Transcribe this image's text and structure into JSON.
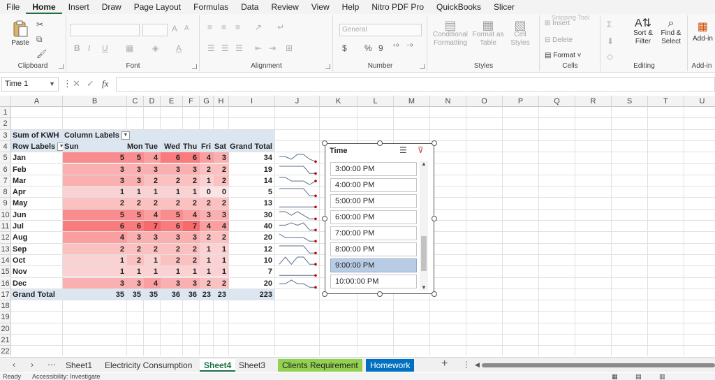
{
  "menu": [
    "File",
    "Home",
    "Insert",
    "Draw",
    "Page Layout",
    "Formulas",
    "Data",
    "Review",
    "View",
    "Help",
    "Nitro PDF Pro",
    "QuickBooks",
    "Slicer"
  ],
  "active_menu": "Home",
  "ribbon": {
    "clipboard": {
      "label": "Clipboard",
      "paste": "Paste"
    },
    "font": {
      "label": "Font",
      "bold": "B",
      "italic": "I",
      "underline": "U"
    },
    "alignment": {
      "label": "Alignment"
    },
    "number": {
      "label": "Number",
      "format": "General",
      "currency": "$",
      "percent": "%",
      "comma": "9"
    },
    "styles": {
      "label": "Styles",
      "conditional": "Conditional Formatting",
      "format_table": "Format as Table",
      "cell_styles": "Cell Styles"
    },
    "cells": {
      "label": "Cells",
      "insert": "Insert",
      "delete": "Delete",
      "format": "Format"
    },
    "editing": {
      "label": "Editing",
      "sort": "Sort & Filter",
      "find": "Find & Select"
    },
    "addins": {
      "label": "Add-in",
      "addins": "Add-in"
    },
    "snipping_tool": "Snipping Tool"
  },
  "formula_bar": {
    "name_box": "Time 1",
    "fx": "fx",
    "value": ""
  },
  "columns": [
    "A",
    "B",
    "C",
    "D",
    "E",
    "F",
    "G",
    "H",
    "I",
    "J",
    "K",
    "L",
    "M",
    "N",
    "O",
    "P",
    "Q",
    "R",
    "S",
    "T",
    "U"
  ],
  "rows": [
    "1",
    "2",
    "3",
    "4",
    "5",
    "6",
    "7",
    "8",
    "9",
    "10",
    "11",
    "12",
    "13",
    "14",
    "15",
    "16",
    "17",
    "18",
    "19",
    "20",
    "21",
    "22"
  ],
  "pivot": {
    "corner": "Sum of KWH",
    "column_labels": "Column Labels",
    "row_labels": "Row Labels",
    "day_headers": [
      "Sun",
      "Mon",
      "Tue",
      "Wed",
      "Thu",
      "Fri",
      "Sat",
      "Grand Total"
    ],
    "rows": [
      {
        "month": "Jan",
        "values": [
          "5",
          "5",
          "4",
          "6",
          "6",
          "4",
          "3"
        ],
        "total": "34"
      },
      {
        "month": "Feb",
        "values": [
          "3",
          "3",
          "3",
          "3",
          "3",
          "2",
          "2"
        ],
        "total": "19"
      },
      {
        "month": "Mar",
        "values": [
          "3",
          "3",
          "2",
          "2",
          "2",
          "1",
          "2"
        ],
        "total": "14"
      },
      {
        "month": "Apr",
        "values": [
          "1",
          "1",
          "1",
          "1",
          "1",
          "0",
          "0"
        ],
        "total": "5"
      },
      {
        "month": "May",
        "values": [
          "2",
          "2",
          "2",
          "2",
          "2",
          "2",
          "2"
        ],
        "total": "13"
      },
      {
        "month": "Jun",
        "values": [
          "5",
          "5",
          "4",
          "5",
          "4",
          "3",
          "3"
        ],
        "total": "30"
      },
      {
        "month": "Jul",
        "values": [
          "6",
          "6",
          "7",
          "6",
          "7",
          "4",
          "4"
        ],
        "total": "40"
      },
      {
        "month": "Aug",
        "values": [
          "4",
          "3",
          "3",
          "3",
          "3",
          "2",
          "2"
        ],
        "total": "20"
      },
      {
        "month": "Sep",
        "values": [
          "2",
          "2",
          "2",
          "2",
          "2",
          "1",
          "1"
        ],
        "total": "12"
      },
      {
        "month": "Oct",
        "values": [
          "1",
          "2",
          "1",
          "2",
          "2",
          "1",
          "1"
        ],
        "total": "10"
      },
      {
        "month": "Nov",
        "values": [
          "1",
          "1",
          "1",
          "1",
          "1",
          "1",
          "1"
        ],
        "total": "7"
      },
      {
        "month": "Dec",
        "values": [
          "3",
          "3",
          "4",
          "3",
          "3",
          "2",
          "2"
        ],
        "total": "20"
      }
    ],
    "grand_total_label": "Grand Total",
    "grand_totals": [
      "35",
      "35",
      "35",
      "36",
      "36",
      "23",
      "23",
      "223"
    ]
  },
  "heat_colors": {
    "low": "#fce4e4",
    "high": "#f8696b"
  },
  "slicer": {
    "title": "Time",
    "items": [
      "3:00:00 PM",
      "4:00:00 PM",
      "5:00:00 PM",
      "6:00:00 PM",
      "7:00:00 PM",
      "8:00:00 PM",
      "9:00:00 PM",
      "10:00:00 PM"
    ],
    "selected": "9:00:00 PM",
    "icons": [
      "multi-select-icon",
      "clear-filter-icon"
    ]
  },
  "sheet_tabs": [
    {
      "label": "Sheet1",
      "style": "normal"
    },
    {
      "label": "Electricity Consumption",
      "style": "normal"
    },
    {
      "label": "Sheet4",
      "style": "active"
    },
    {
      "label": "Sheet3",
      "style": "normal"
    },
    {
      "label": "Clients Requirement",
      "style": "green"
    },
    {
      "label": "Homework",
      "style": "blue"
    }
  ],
  "status": {
    "ready": "Ready",
    "accessibility": "Accessibility: Investigate"
  }
}
